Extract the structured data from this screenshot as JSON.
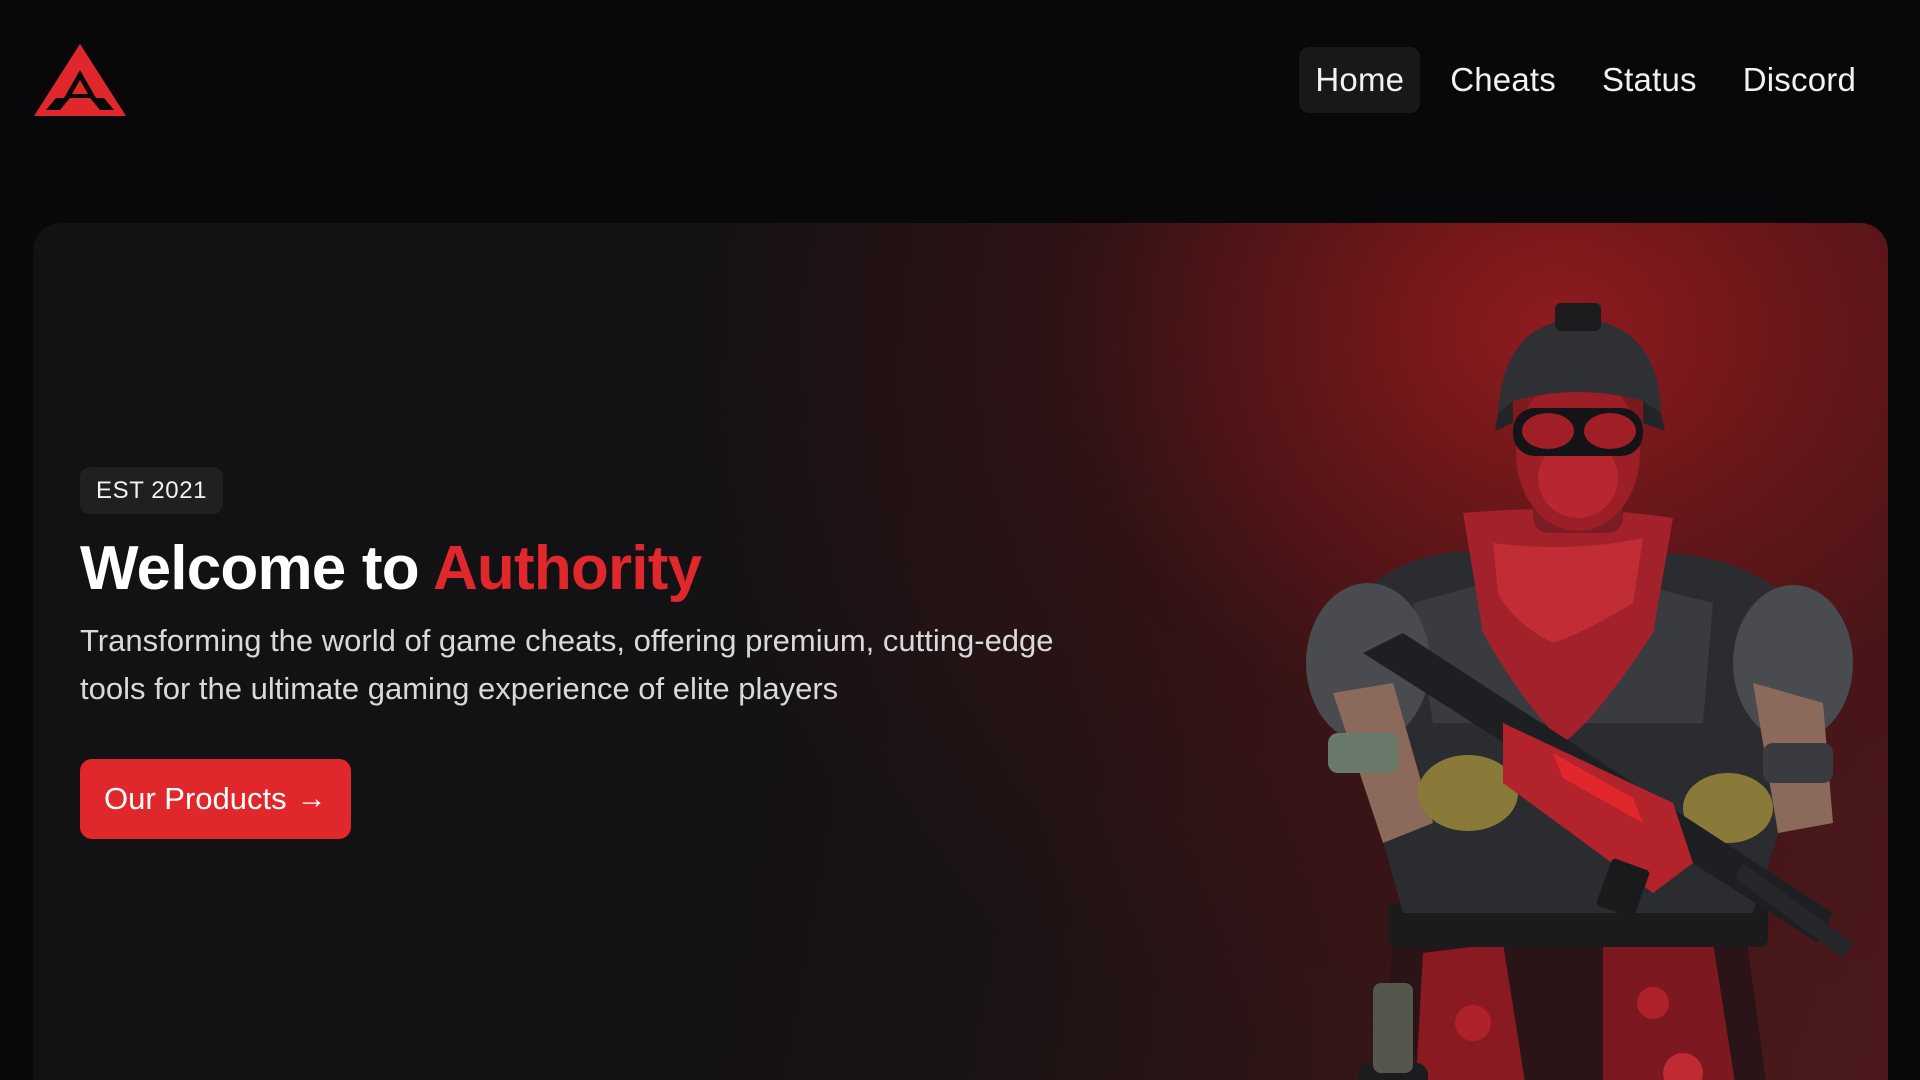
{
  "brand": {
    "logo_icon": "authority-triangle-logo",
    "accent_color": "#e0282c"
  },
  "nav": {
    "items": [
      {
        "label": "Home",
        "active": true
      },
      {
        "label": "Cheats",
        "active": false
      },
      {
        "label": "Status",
        "active": false
      },
      {
        "label": "Discord",
        "active": false
      }
    ]
  },
  "hero": {
    "badge": "EST 2021",
    "title_prefix": "Welcome to ",
    "title_highlight": "Authority",
    "subtitle": "Transforming the world of game cheats, offering premium, cutting-edge tools for the ultimate gaming experience of elite players",
    "cta_label": "Our Products",
    "cta_icon": "arrow-right-icon",
    "image_icon": "soldier-character-image"
  }
}
